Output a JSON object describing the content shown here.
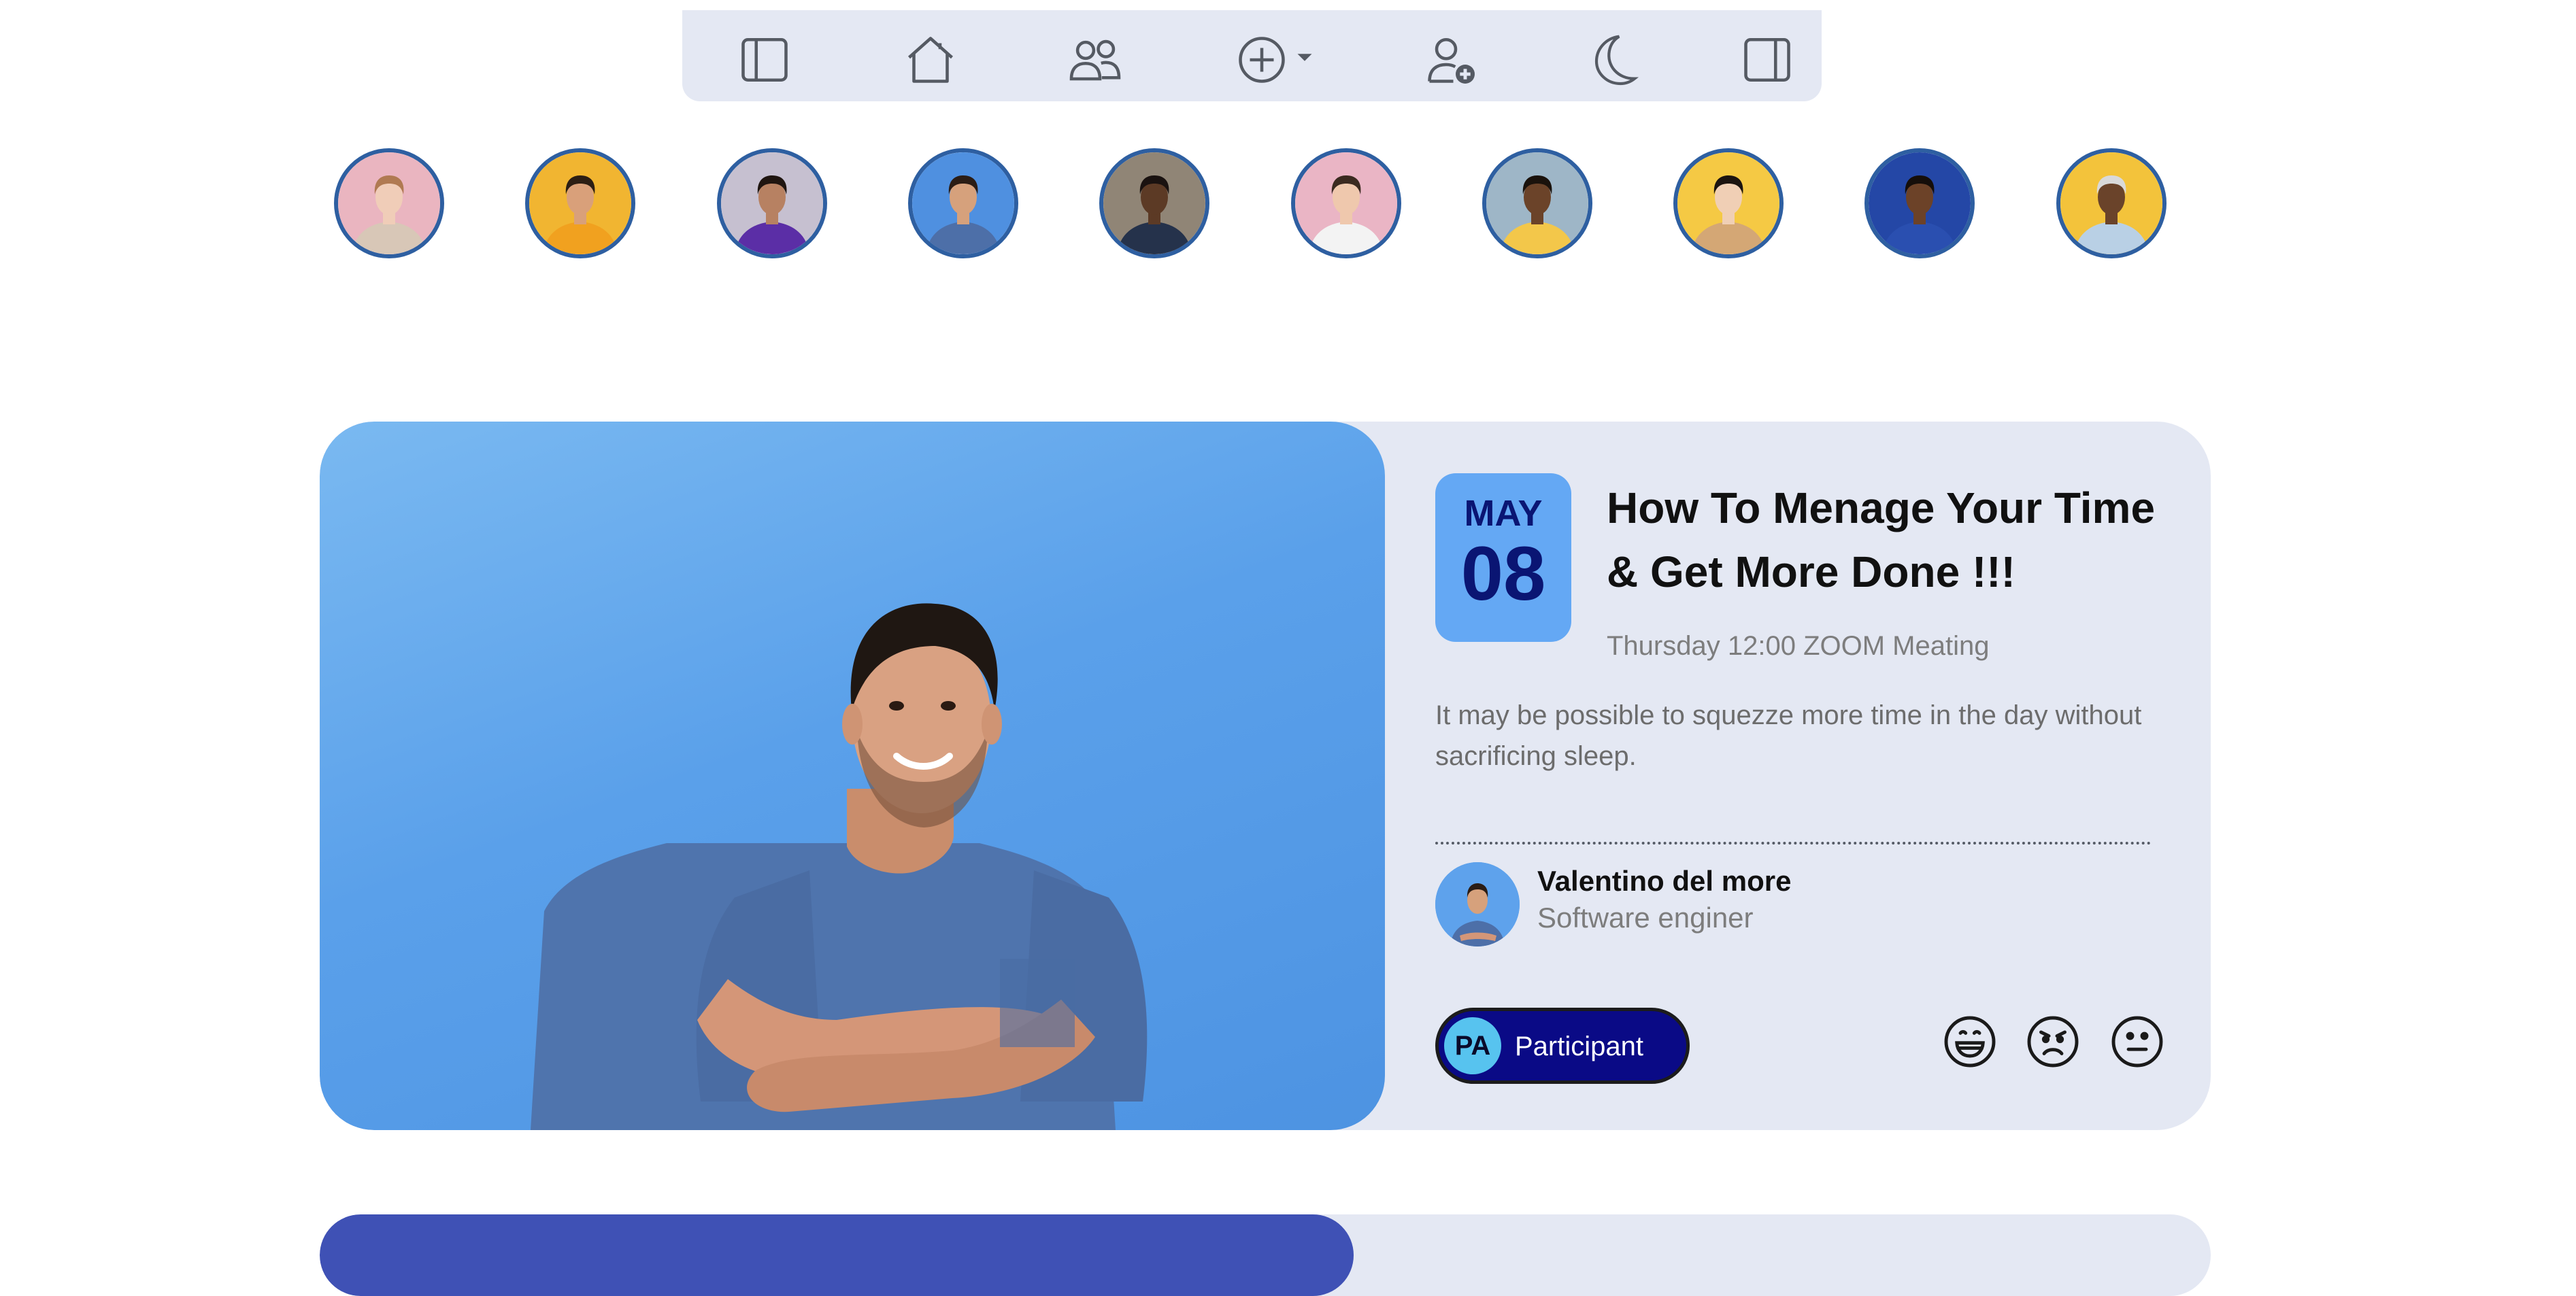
{
  "toolbar": {
    "icons": [
      "left-sidebar-icon",
      "home-icon",
      "people-icon",
      "add-circle-icon",
      "add-user-icon",
      "moon-icon",
      "right-sidebar-icon"
    ]
  },
  "stories": {
    "avatars": [
      {
        "bg": "#eab5c0",
        "shirt": "#d8c7b7",
        "skin": "#f0cdb8",
        "hair": "#b07a52"
      },
      {
        "bg": "#f1b531",
        "shirt": "#f1a11f",
        "skin": "#d9a07a",
        "hair": "#2c1e14"
      },
      {
        "bg": "#c6c0d0",
        "shirt": "#5b2ea6",
        "skin": "#b78162",
        "hair": "#1f1510"
      },
      {
        "bg": "#4f90e0",
        "shirt": "#4d6fa8",
        "skin": "#d6a17c",
        "hair": "#2b1d15"
      },
      {
        "bg": "#908576",
        "shirt": "#25324b",
        "skin": "#5c3a25",
        "hair": "#1a1210"
      },
      {
        "bg": "#eab5c5",
        "shirt": "#f3f3f3",
        "skin": "#efc8ad",
        "hair": "#3b2a20"
      },
      {
        "bg": "#9eb6c7",
        "shirt": "#f3c74a",
        "skin": "#6b4329",
        "hair": "#1a120c"
      },
      {
        "bg": "#f5c944",
        "shirt": "#d4a775",
        "skin": "#f0cfb5",
        "hair": "#1c1410"
      },
      {
        "bg": "#2447a6",
        "shirt": "#2a4fb0",
        "skin": "#6c4228",
        "hair": "#150e0a"
      },
      {
        "bg": "#f3c33b",
        "shirt": "#b9d0e5",
        "skin": "#6a432a",
        "hair": "#d9d9d9"
      }
    ]
  },
  "event": {
    "month": "MAY",
    "day": "08",
    "title": "How To Menage Your Time & Get More Done !!!",
    "meta": "Thursday 12:00 ZOOM Meating",
    "description": "It may be possible to squezze more time in the day without sacrificing sleep.",
    "host": {
      "name": "Valentino del more",
      "role": "Software enginer"
    },
    "participant_initials": "PA",
    "participant_label": "Participant",
    "reactions": [
      "grinning-face-icon",
      "angry-face-icon",
      "neutral-face-icon"
    ]
  },
  "colors": {
    "panel_bg": "#e4e8f3",
    "date_badge": "#64a8f4",
    "date_text": "#0a1573",
    "participant_button": "#0a0a86",
    "participant_circle": "#57c3ef",
    "avatar_border": "#2e5fa1",
    "next_card_accent": "#3f51b5"
  }
}
